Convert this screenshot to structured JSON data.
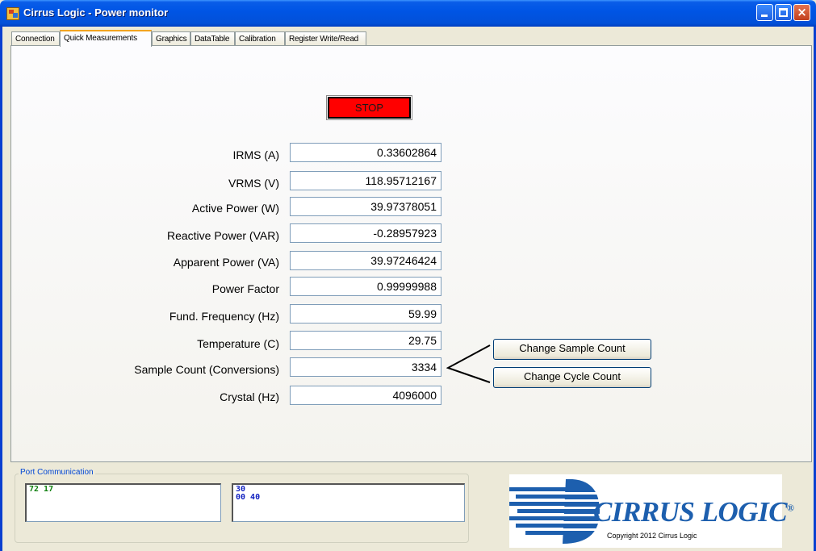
{
  "window": {
    "title": "Cirrus Logic - Power monitor",
    "close_glyph": "×"
  },
  "tabs": [
    {
      "label": "Connection"
    },
    {
      "label": "Quick Measurements",
      "active": true
    },
    {
      "label": "Graphics"
    },
    {
      "label": "DataTable"
    },
    {
      "label": "Calibration"
    },
    {
      "label": "Register Write/Read"
    }
  ],
  "stop_button": {
    "label": "STOP",
    "color": "#ff0000"
  },
  "measurements": [
    {
      "label": "IRMS (A)",
      "value": "0.33602864"
    },
    {
      "label": "VRMS (V)",
      "value": "118.95712167"
    },
    {
      "label": "Active Power (W)",
      "value": "39.97378051"
    },
    {
      "label": "Reactive Power (VAR)",
      "value": "-0.28957923"
    },
    {
      "label": "Apparent Power (VA)",
      "value": "39.97246424"
    },
    {
      "label": "Power Factor",
      "value": "0.99999988"
    },
    {
      "label": "Fund. Frequency (Hz)",
      "value": "59.99"
    },
    {
      "label": "Temperature (C)",
      "value": "29.75"
    },
    {
      "label": "Sample Count (Conversions)",
      "value": "3334"
    },
    {
      "label": "Crystal (Hz)",
      "value": "4096000"
    }
  ],
  "buttons": {
    "change_sample_count": "Change Sample Count",
    "change_cycle_count": "Change Cycle Count"
  },
  "port_communication": {
    "legend": "Port Communication",
    "tx_text": "72 17",
    "rx_line1": "30",
    "rx_line2": "00 40",
    "tx_color": "#108010",
    "rx_color": "#1020c0"
  },
  "logo": {
    "brand": "CIRRUS LOGIC",
    "registered_mark": "®",
    "copyright": "Copyright 2012 Cirrus Logic",
    "color": "#1d5fae"
  }
}
